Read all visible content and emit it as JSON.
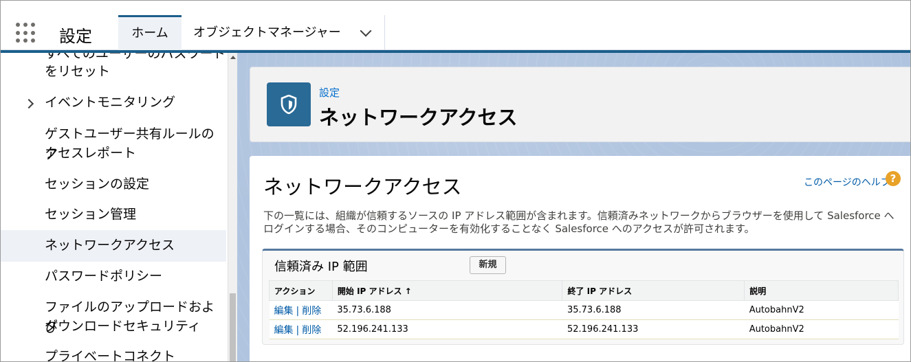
{
  "topbar": {
    "app_title": "設定",
    "tabs": [
      {
        "label": "ホーム",
        "active": true
      },
      {
        "label": "オブジェクトマネージャー",
        "has_dropdown": true
      }
    ]
  },
  "sidebar": {
    "items": [
      {
        "label": "すべてのユーザーのパスワード"
      },
      {
        "label": "をリセット"
      },
      {
        "label": "イベントモニタリング",
        "expandable": true
      },
      {
        "label": "ゲストユーザー共有ルールのア"
      },
      {
        "label": "クセスレポート"
      },
      {
        "label": "セッションの設定"
      },
      {
        "label": "セッション管理"
      },
      {
        "label": "ネットワークアクセス",
        "active": true
      },
      {
        "label": "パスワードポリシー"
      },
      {
        "label": "ファイルのアップロードおよび"
      },
      {
        "label": "ダウンロードセキュリティ"
      },
      {
        "label": "プライベートコネクト"
      }
    ]
  },
  "header": {
    "breadcrumb": "設定",
    "title": "ネットワークアクセス",
    "icon": "shield-icon",
    "icon_color": "#2a6a96"
  },
  "content": {
    "title": "ネットワークアクセス",
    "help_link": "このページのヘルプ",
    "help_icon": "question-icon",
    "description": "下の一覧には、組織が信頼するソースの IP アドレス範囲が含まれます。信頼済みネットワークからブラウザーを使用して Salesforce へログインする場合、そのコンピューターを有効化することなく Salesforce へのアクセスが許可されます。"
  },
  "related_list": {
    "title": "信頼済み IP 範囲",
    "new_button": "新規",
    "columns": [
      "アクション",
      "開始 IP アドレス ↑",
      "終了 IP アドレス",
      "説明"
    ],
    "rows": [
      {
        "edit": "編集",
        "sep": "|",
        "delete": "削除",
        "start_ip": "35.73.6.188",
        "end_ip": "35.73.6.188",
        "description": "AutobahnV2"
      },
      {
        "edit": "編集",
        "sep": "|",
        "delete": "削除",
        "start_ip": "52.196.241.133",
        "end_ip": "52.196.241.133",
        "description": "AutobahnV2"
      }
    ]
  },
  "colors": {
    "brand": "#1b5f8c",
    "link": "#015ba7",
    "background": "#b0c4df"
  }
}
